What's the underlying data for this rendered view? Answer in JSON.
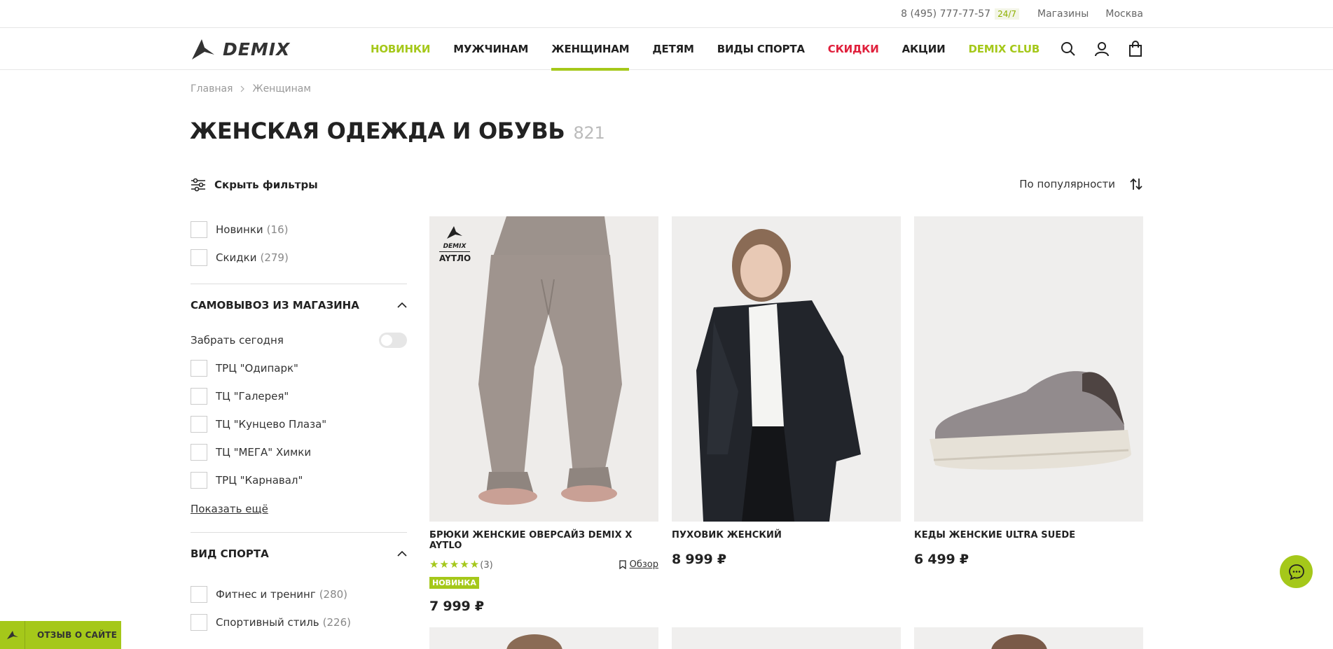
{
  "topbar": {
    "phone": "8 (495) 777-77-57",
    "badge": "24/7",
    "stores": "Магазины",
    "city": "Москва"
  },
  "header": {
    "logo_text": "DEMIX",
    "nav": [
      {
        "label": "НОВИНКИ",
        "color": "#a5c81a"
      },
      {
        "label": "МУЖЧИНАМ",
        "color": "#222222"
      },
      {
        "label": "ЖЕНЩИНАМ",
        "color": "#222222"
      },
      {
        "label": "ДЕТЯМ",
        "color": "#222222"
      },
      {
        "label": "ВИДЫ СПОРТА",
        "color": "#222222"
      },
      {
        "label": "СКИДКИ",
        "color": "#e0203c"
      },
      {
        "label": "АКЦИИ",
        "color": "#222222"
      },
      {
        "label": "DEMIX CLUB",
        "color": "#a5c81a"
      }
    ],
    "icons": [
      "search-icon",
      "user-icon",
      "bag-icon"
    ]
  },
  "breadcrumb": [
    "Главная",
    "Женщинам"
  ],
  "page": {
    "title": "ЖЕНСКАЯ ОДЕЖДА И ОБУВЬ",
    "count": "821"
  },
  "filters": {
    "toggle_label": "Скрыть фильтры",
    "quick": [
      {
        "label": "Новинки",
        "count": "(16)"
      },
      {
        "label": "Скидки",
        "count": "(279)"
      }
    ],
    "pickup": {
      "title": "САМОВЫВОЗ ИЗ МАГАЗИНА",
      "today_label": "Забрать сегодня",
      "stores": [
        "ТРЦ \"Одипарк\"",
        "ТЦ \"Галерея\"",
        "ТЦ \"Кунцево Плаза\"",
        "ТЦ \"МЕГА\" Химки",
        "ТРЦ \"Карнавал\""
      ],
      "show_more": "Показать ещё"
    },
    "sport": {
      "title": "ВИД СПОРТА",
      "items": [
        {
          "label": "Фитнес и тренинг",
          "count": "(280)"
        },
        {
          "label": "Спортивный стиль",
          "count": "(226)"
        }
      ]
    }
  },
  "sort": {
    "label": "По популярности"
  },
  "products": [
    {
      "name": "БРЮКИ ЖЕНСКИЕ ОВЕРСАЙЗ DEMIX X AYTLO",
      "rating": 5,
      "rating_count": "(3)",
      "review_label": "Обзор",
      "badge": "НОВИНКА",
      "price": "7 999 ₽",
      "image_label_brand": "DEMIX",
      "image_label_collab": "AYTЛO"
    },
    {
      "name": "ПУХОВИК ЖЕНСКИЙ",
      "price": "8 999 ₽"
    },
    {
      "name": "КЕДЫ ЖЕНСКИЕ ULTRA SUEDE",
      "price": "6 499 ₽"
    }
  ],
  "feedback": {
    "label": "ОТЗЫВ О САЙТЕ"
  },
  "colors": {
    "accent": "#a5c81a",
    "sale": "#e0203c"
  }
}
